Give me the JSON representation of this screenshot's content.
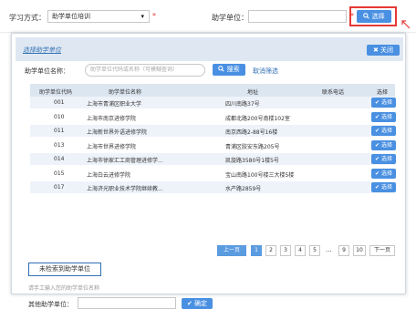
{
  "form": {
    "study_mode_label": "学习方式：",
    "study_mode_value": "助学单位培训",
    "study_mode_arrow": "▾",
    "required_mark": "*",
    "unit_label": "助学单位：",
    "select_button": "选择"
  },
  "modal": {
    "title": "选择助学单位",
    "close": "关闭",
    "search_label": "助学单位名称：",
    "search_placeholder": "助学单位代码或名称（可模糊查询）",
    "search_button": "搜索",
    "reset": "取消筛选",
    "columns": [
      "助学单位代码",
      "助学单位名称",
      "地址",
      "联系电话",
      "选择"
    ],
    "rows": [
      {
        "code": "001",
        "name": "上海市青浦区职业大学",
        "address": "四川南路37号",
        "phone": "",
        "action": "选择"
      },
      {
        "code": "010",
        "name": "上海市南京进修学院",
        "address": "成都北路200号南楼102室",
        "phone": "",
        "action": "选择"
      },
      {
        "code": "011",
        "name": "上海新世界外语进修学院",
        "address": "南京西路2-88号16楼",
        "phone": "",
        "action": "选择"
      },
      {
        "code": "013",
        "name": "上海市世界进修学院",
        "address": "青浦区胶安东路205号",
        "phone": "",
        "action": "选择"
      },
      {
        "code": "014",
        "name": "上海市徐家汇工商管理进修学...",
        "address": "凯旋路3580号1楼5号",
        "phone": "",
        "action": "选择"
      },
      {
        "code": "015",
        "name": "上海白云进修学院",
        "address": "宝山南路100号楼三大楼5楼",
        "phone": "",
        "action": "选择"
      },
      {
        "code": "017",
        "name": "上海济光职业技术学院继续教...",
        "address": "水产路2859号",
        "phone": "",
        "action": "选择"
      }
    ],
    "pagination": {
      "prev": "上一页",
      "pages": [
        "1",
        "2",
        "3",
        "4",
        "5"
      ],
      "current": "1",
      "ellipsis": "...",
      "tail_pages": [
        "9",
        "10"
      ],
      "next": "下一页"
    },
    "not_found_button": "未检索到助学单位",
    "hint": "请手工输入您的助学单位名称",
    "other_label": "其他助学单位：",
    "confirm_button": "确定"
  }
}
